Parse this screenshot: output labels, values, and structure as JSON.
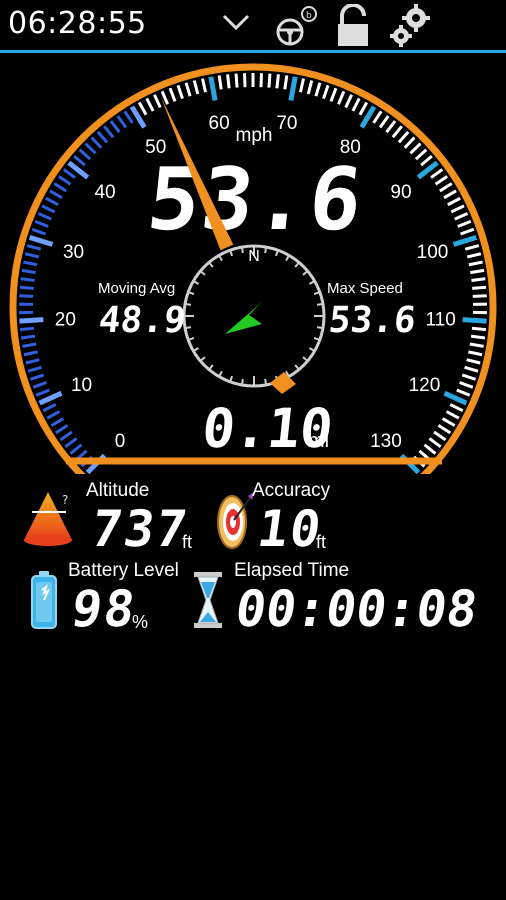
{
  "status_bar": {
    "time": "06:28:55",
    "icons": [
      "chevron-down-icon",
      "steering-wheel-icon",
      "lock-icon",
      "gears-icon"
    ],
    "accent_color": "#29a8df"
  },
  "speedometer": {
    "speed_display": "53.6",
    "unit": "mph",
    "needle_value": 53.6,
    "scale_min": 0,
    "scale_max": 130,
    "scale_labels": [
      "0",
      "10",
      "20",
      "30",
      "40",
      "50",
      "60",
      "70",
      "80",
      "90",
      "100",
      "110",
      "120",
      "130"
    ],
    "moving_avg_label": "Moving Avg",
    "moving_avg_value": "48.9",
    "max_speed_label": "Max Speed",
    "max_speed_value": "53.6",
    "distance_value": "0.10",
    "distance_unit": "mi",
    "compass_letter": "N",
    "colors": {
      "ring": "#f0901e",
      "arc_low": "#2f60e0",
      "needle": "#f0901e",
      "compass_arrow": "#22cc22",
      "tick_accent": "#29a8df"
    }
  },
  "stats": {
    "altitude_label": "Altitude",
    "altitude_value": "737",
    "altitude_unit": "ft",
    "accuracy_label": "Accuracy",
    "accuracy_value": "10",
    "accuracy_unit": "ft",
    "battery_label": "Battery Level",
    "battery_value": "98",
    "battery_unit": "%",
    "elapsed_label": "Elapsed Time",
    "elapsed_value": "00:00:08"
  }
}
